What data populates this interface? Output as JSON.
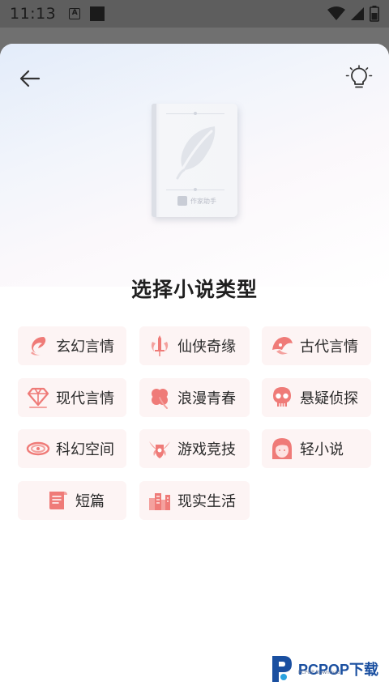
{
  "status_bar": {
    "time": "11:13",
    "notification_letter": "A"
  },
  "header": {
    "back_icon": "arrow-left-icon",
    "tip_icon": "lightbulb-icon"
  },
  "cover": {
    "brand_text": "作家助手"
  },
  "page_title": "选择小说类型",
  "genres": [
    {
      "label": "玄幻言情",
      "icon": "phoenix-icon"
    },
    {
      "label": "仙侠奇缘",
      "icon": "sword-icon"
    },
    {
      "label": "古代言情",
      "icon": "fan-icon"
    },
    {
      "label": "现代言情",
      "icon": "diamond-icon"
    },
    {
      "label": "浪漫青春",
      "icon": "clover-icon"
    },
    {
      "label": "悬疑侦探",
      "icon": "skull-icon"
    },
    {
      "label": "科幻空间",
      "icon": "galaxy-icon"
    },
    {
      "label": "游戏竞技",
      "icon": "winged-shield-icon"
    },
    {
      "label": "轻小说",
      "icon": "girl-face-icon"
    },
    {
      "label": "短篇",
      "icon": "scroll-icon"
    },
    {
      "label": "现实生活",
      "icon": "city-icon"
    }
  ],
  "watermark": {
    "text": "PCPOP下载",
    "subtext": "PCPOP Download"
  },
  "colors": {
    "accent": "#e8736f",
    "chip_bg": "#fdf4f4"
  }
}
